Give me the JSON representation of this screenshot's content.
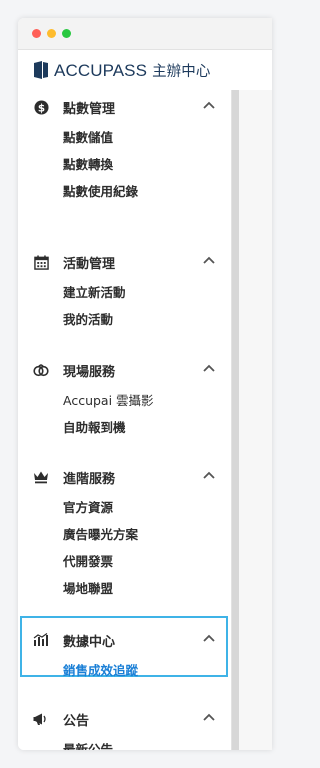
{
  "window": {
    "traffic_lights": {
      "close": "#ff5f57",
      "minimize": "#febc2e",
      "zoom": "#28c840"
    }
  },
  "brand": {
    "name": "ACCUPASS",
    "subtitle": "主辦中心",
    "color": "#1d3a5c"
  },
  "sidebar": {
    "groups": [
      {
        "title": "點數管理",
        "icon": "dollar-coin-icon",
        "items": [
          "點數儲值",
          "點數轉換",
          "點數使用紀錄"
        ]
      },
      {
        "title": "活動管理",
        "icon": "calendar-icon",
        "items": [
          "建立新活動",
          "我的活動"
        ]
      },
      {
        "title": "現場服務",
        "icon": "camera-link-icon",
        "items": [
          "Accupai 雲攝影",
          "自助報到機"
        ]
      },
      {
        "title": "進階服務",
        "icon": "crown-icon",
        "items": [
          "官方資源",
          "廣告曝光方案",
          "代開發票",
          "場地聯盟"
        ]
      },
      {
        "title": "數據中心",
        "icon": "bar-chart-icon",
        "items": [
          "銷售成效追蹤"
        ],
        "active_item": "銷售成效追蹤"
      },
      {
        "title": "公告",
        "icon": "megaphone-icon",
        "items": [
          "最新公告"
        ]
      }
    ]
  },
  "colors": {
    "active_link": "#1a7fd6",
    "highlight_border": "#3fb3e7",
    "text": "#2d2d2d"
  }
}
